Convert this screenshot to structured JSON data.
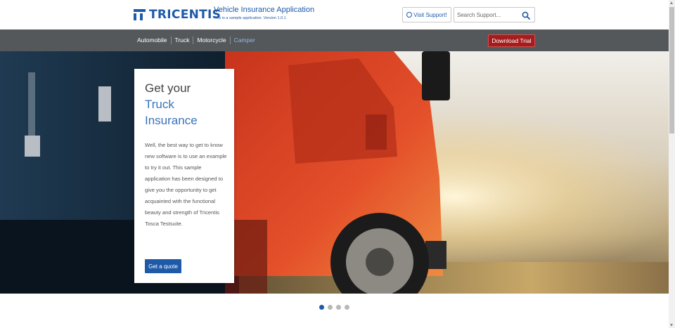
{
  "header": {
    "logo_text": "TRICENTIS",
    "app_title": "Vehicle Insurance Application",
    "app_subtitle": "This is a sample application. Version 1.0.1",
    "visit_support_label": "Visit Support!",
    "search": {
      "placeholder": "Search Support...",
      "value": ""
    }
  },
  "navbar": {
    "items": [
      {
        "label": "Automobile",
        "active": false
      },
      {
        "label": "Truck",
        "active": false
      },
      {
        "label": "Motorcycle",
        "active": false
      },
      {
        "label": "Camper",
        "active": true
      }
    ],
    "download_label": "Download Trial"
  },
  "hero": {
    "title_line1": "Get your",
    "title_line2": "Truck",
    "title_line3": "Insurance",
    "description": "Well, the best way to get to know new software is to use an example to try it out. This sample application has been designed to give you the opportunity to get acquainted with the functional beauty and strength of Tricentis Tosca Testsuite.",
    "cta_label": "Get a quote",
    "image_subject": "red-truck-photo"
  },
  "carousel": {
    "slide_count": 4,
    "active_index": 0
  },
  "colors": {
    "brand_blue": "#1e5aa8",
    "navbar_gray": "#55585b",
    "download_red": "#a51c1c",
    "active_nav": "#8fb8e6"
  }
}
